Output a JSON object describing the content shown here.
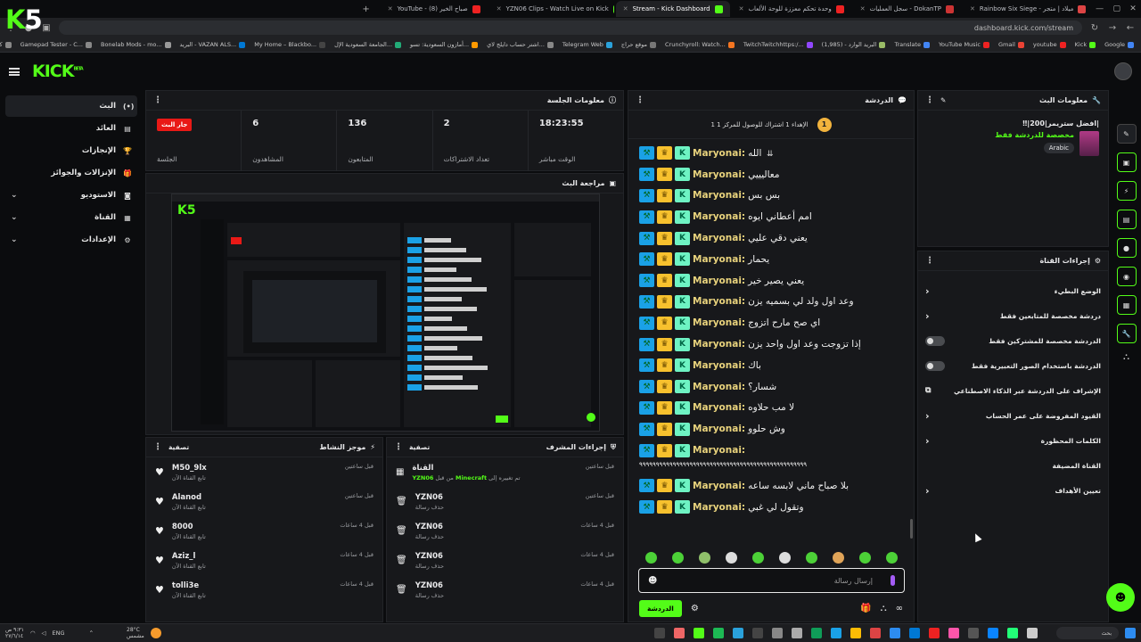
{
  "browser": {
    "tabs": [
      {
        "label": "Rainbow Six Siege - ميلاد | متجر",
        "color": "#d44"
      },
      {
        "label": "سجل العمليات - DokanTP",
        "color": "#c33"
      },
      {
        "label": "وحدة تحكم معززة للوحة الألعاب",
        "color": "#e22"
      },
      {
        "label": "Stream - Kick Dashboard",
        "color": "#53fc18",
        "active": true
      },
      {
        "label": "YZN06 Clips - Watch Live on Kick",
        "color": "#53fc18"
      },
      {
        "label": "YouTube - صباح الخير (8)",
        "color": "#e22"
      }
    ],
    "url": "dashboard.kick.com/stream",
    "bookmarks": [
      {
        "label": "Google",
        "color": "#4285f4"
      },
      {
        "label": "Kick",
        "color": "#53fc18"
      },
      {
        "label": "youtube",
        "color": "#e22"
      },
      {
        "label": "Gmail",
        "color": "#ea4335"
      },
      {
        "label": "YouTube Music",
        "color": "#e22"
      },
      {
        "label": "Translate",
        "color": "#4285f4"
      },
      {
        "label": "البريد الوارد - (1,985)",
        "color": "#9b6"
      },
      {
        "label": "TwitchTwitchhttps:/...",
        "color": "#9147ff"
      },
      {
        "label": "Crunchyroll: Watch...",
        "color": "#f47521"
      },
      {
        "label": "موقع حراج",
        "color": "#777"
      },
      {
        "label": "Telegram Web",
        "color": "#2aa1da"
      },
      {
        "label": "اشتر حساب دايلج لاي...",
        "color": "#888"
      },
      {
        "label": "أمازون السعودية: تسو...",
        "color": "#f90"
      },
      {
        "label": "الجامعة السعودية الإل...",
        "color": "#2a7"
      },
      {
        "label": "My Home – Blackbo...",
        "color": "#444"
      },
      {
        "label": "البريد - VAZAN ALS...",
        "color": "#0078d4"
      },
      {
        "label": "Bonelab Mods - mo...",
        "color": "#999"
      },
      {
        "label": "Gamepad Tester - C...",
        "color": "#888"
      },
      {
        "label": "كل الإشارات المرجعية",
        "color": "#888"
      }
    ]
  },
  "sidebar": {
    "items": [
      {
        "label": "البث",
        "icon": "broadcast-icon",
        "active": true
      },
      {
        "label": "العائد",
        "icon": "wallet-icon"
      },
      {
        "label": "الإنجازات",
        "icon": "trophy-icon"
      },
      {
        "label": "الإنزالات والجوائز",
        "icon": "gift-icon"
      },
      {
        "label": "الاستوديو",
        "icon": "studio-icon",
        "expandable": true
      },
      {
        "label": "القناة",
        "icon": "channel-icon",
        "expandable": true
      },
      {
        "label": "الإعدادات",
        "icon": "gear-icon",
        "expandable": true
      }
    ]
  },
  "session": {
    "title": "معلومات الجلسة",
    "stats": [
      {
        "value": "جار البث",
        "label": "الجلسة",
        "badge": true
      },
      {
        "value": "6",
        "label": "المشاهدون"
      },
      {
        "value": "136",
        "label": "المتابعون"
      },
      {
        "value": "2",
        "label": "تعداد الاشتراكات"
      },
      {
        "value": "18:23:55",
        "label": "الوقت مباشر"
      }
    ]
  },
  "preview": {
    "title": "مراجعة البث"
  },
  "activity": {
    "title": "موجز النشاط",
    "filter": "تصفية",
    "rows": [
      {
        "name": "M50_9lx",
        "sub": "تابع القناة الآن",
        "time": "قبل ساعتين"
      },
      {
        "name": "Alanod",
        "sub": "تابع القناة الآن",
        "time": "قبل ساعتين"
      },
      {
        "name": "8000",
        "sub": "تابع القناة الآن",
        "time": "قبل 4 ساعات"
      },
      {
        "name": "Aziz_l",
        "sub": "تابع القناة الآن",
        "time": "قبل 4 ساعات"
      },
      {
        "name": "tolli3e",
        "sub": "تابع القناة الآن",
        "time": "قبل 4 ساعات"
      }
    ]
  },
  "modactions": {
    "title": "إجراءات المشرف",
    "filter": "تصفية",
    "rows": [
      {
        "name": "القناة",
        "sub_prefix": "تم تغييره إلى",
        "sub_game": "Minecraft",
        "sub_by": "من قبل",
        "sub_user": "YZN06",
        "time": "قبل ساعتين",
        "icon": "channel-icon"
      },
      {
        "name": "YZN06",
        "sub": "حذف رسالة",
        "time": "قبل ساعتين",
        "icon": "trash-icon"
      },
      {
        "name": "YZN06",
        "sub": "حذف رسالة",
        "time": "قبل 4 ساعات",
        "icon": "trash-icon"
      },
      {
        "name": "YZN06",
        "sub": "حذف رسالة",
        "time": "قبل 4 ساعات",
        "icon": "trash-icon"
      },
      {
        "name": "YZN06",
        "sub": "حذف رسالة",
        "time": "قبل 4 ساعات",
        "icon": "trash-icon"
      }
    ]
  },
  "chat": {
    "title": "الدردشة",
    "pinned": "1 الإهداء 1 اشتراك للوصول للمركز 1",
    "pinned_rank": "1",
    "messages": [
      {
        "user": "Maryonai",
        "text": "الله"
      },
      {
        "user": "Maryonai",
        "text": "معاليييي"
      },
      {
        "user": "Maryonai",
        "text": "بس بس"
      },
      {
        "user": "Maryonai",
        "text": "امم أعطاني ايوه"
      },
      {
        "user": "Maryonai",
        "text": "يعني دقي عليي"
      },
      {
        "user": "Maryonai",
        "text": "يحمار"
      },
      {
        "user": "Maryonai",
        "text": "يعني يصير خير"
      },
      {
        "user": "Maryonai",
        "text": "وعد اول ولد لي بسميه يزن"
      },
      {
        "user": "Maryonai",
        "text": "اي صح مارح اتزوج"
      },
      {
        "user": "Maryonai",
        "text": "إذا تزوجت وعد اول واحد يزن"
      },
      {
        "user": "Maryonai",
        "text": "باك"
      },
      {
        "user": "Maryonai",
        "text": "شسار؟"
      },
      {
        "user": "Maryonai",
        "text": "لا مب حلاوه"
      },
      {
        "user": "Maryonai",
        "text": "وش حلوو"
      },
      {
        "user": "Maryonai",
        "text": "",
        "wrap": "٩٩٩٩٩٩٩٩٩٩٩٩٩٩٩٩٩٩٩٩٩٩٩٩٩٩٩٩٩٩٩٩٩٩٩٩٩٩٩٩٩٩٩٩٩٩٩٩٩٩"
      },
      {
        "user": "Maryonai",
        "text": "بلا صباح ماني لابسه ساعه"
      },
      {
        "user": "Maryonai",
        "text": "وتقول لي غبي"
      }
    ],
    "input_placeholder": "إرسال رسالة",
    "send_label": "الدردشة"
  },
  "streaminfo": {
    "title": "معلومات البث",
    "stream_title": "|افضل ستريمر|200|‼",
    "category": "مخصصة للدردشة فقط",
    "language": "Arabic"
  },
  "channelactions": {
    "title": "إجراءات القناة",
    "rows": [
      {
        "label": "الوضع البطيء",
        "control": "chevron"
      },
      {
        "label": "دردشة مخصصة للمتابعين فقط",
        "control": "chevron"
      },
      {
        "label": "الدردشة مخصصة للمشتركين فقط",
        "control": "toggle"
      },
      {
        "label": "الدردشة باستخدام الصور التعبيرية فقط",
        "control": "toggle"
      },
      {
        "label": "الإشراف على الدردشة عبر الذكاء الاصطناعي",
        "control": "external"
      },
      {
        "label": "القيود المفروضة على عمر الحساب",
        "control": "chevron"
      },
      {
        "label": "الكلمات المحظورة",
        "control": "chevron"
      },
      {
        "label": "القناة المضيفة",
        "control": "none"
      },
      {
        "label": "تعيين الأهداف",
        "control": "chevron"
      }
    ]
  },
  "overlay": {
    "logo_k": "K",
    "logo_num": "5"
  },
  "kick": {
    "logo": "KICK",
    "logo_sup": "BETA"
  },
  "taskbar": {
    "weather": "28°C",
    "weather_sub": "مشمس",
    "lang": "ENG",
    "time": "٩:٣١ ص",
    "date": "٢٧/٦/١٤",
    "search": "بحث"
  },
  "colors": {
    "accent": "#53fc18",
    "live": "#e91916",
    "panel": "#17181b",
    "bg": "#0b0c0e"
  }
}
